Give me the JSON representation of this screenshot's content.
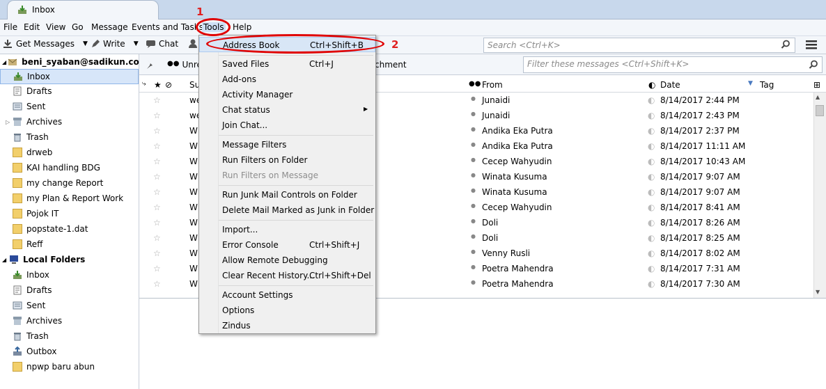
{
  "tab": {
    "title": "Inbox"
  },
  "menubar": [
    "File",
    "Edit",
    "View",
    "Go",
    "Message",
    "Events and Tasks",
    "Tools",
    "Help"
  ],
  "toolbar": {
    "get_messages": "Get Messages",
    "write": "Write",
    "chat": "Chat",
    "search_placeholder": "Search <Ctrl+K>"
  },
  "quickfilter": {
    "unread": "Unre",
    "attachment": "chment",
    "filter_placeholder": "Filter these messages <Ctrl+Shift+K>"
  },
  "columns": {
    "subject": "Su",
    "from": "From",
    "date": "Date",
    "tag": "Tag"
  },
  "folders": {
    "account1": "beni_syaban@sadikun.com",
    "account1_items": [
      "Inbox",
      "Drafts",
      "Sent",
      "Archives",
      "Trash",
      "drweb",
      "KAI handling BDG",
      "my change Report",
      "my Plan & Report Work",
      "Pojok IT",
      "popstate-1.dat",
      "Reff"
    ],
    "account2": "Local Folders",
    "account2_items": [
      "Inbox",
      "Drafts",
      "Sent",
      "Archives",
      "Trash",
      "Outbox",
      "npwp baru abun"
    ]
  },
  "messages": [
    {
      "subject": "we",
      "from": "Junaidi",
      "date": "8/14/2017 2:44 PM"
    },
    {
      "subject": "we",
      "from": "Junaidi",
      "date": "8/14/2017 2:43 PM"
    },
    {
      "subject": "W",
      "from": "Andika Eka Putra",
      "date": "8/14/2017 2:37 PM"
    },
    {
      "subject": "W",
      "from": "Andika Eka Putra",
      "date": "8/14/2017 11:11 AM"
    },
    {
      "subject": "W",
      "from": "Cecep Wahyudin",
      "date": "8/14/2017 10:43 AM"
    },
    {
      "subject": "W",
      "from": "Winata Kusuma",
      "date": "8/14/2017 9:07 AM"
    },
    {
      "subject": "W",
      "from": "Winata Kusuma",
      "date": "8/14/2017 9:07 AM"
    },
    {
      "subject": "W",
      "from": "Cecep Wahyudin",
      "date": "8/14/2017 8:41 AM"
    },
    {
      "subject": "W",
      "from": "Doli",
      "date": "8/14/2017 8:26 AM"
    },
    {
      "subject": "W",
      "from": "Doli",
      "date": "8/14/2017 8:25 AM"
    },
    {
      "subject": "W",
      "from": "Venny Rusli",
      "date": "8/14/2017 8:02 AM"
    },
    {
      "subject": "W",
      "from": "Poetra Mahendra",
      "date": "8/14/2017 7:31 AM"
    },
    {
      "subject": "W",
      "from": "Poetra Mahendra",
      "date": "8/14/2017 7:30 AM"
    }
  ],
  "tools_menu": [
    {
      "label": "Address Book",
      "shortcut": "Ctrl+Shift+B"
    },
    {
      "label": "Saved Files",
      "shortcut": "Ctrl+J"
    },
    {
      "label": "Add-ons",
      "shortcut": ""
    },
    {
      "label": "Activity Manager",
      "shortcut": ""
    },
    {
      "label": "Chat status",
      "shortcut": ""
    },
    {
      "label": "Join Chat...",
      "shortcut": ""
    },
    {
      "label": "Message Filters",
      "shortcut": ""
    },
    {
      "label": "Run Filters on Folder",
      "shortcut": ""
    },
    {
      "label": "Run Filters on Message",
      "shortcut": ""
    },
    {
      "label": "Run Junk Mail Controls on Folder",
      "shortcut": ""
    },
    {
      "label": "Delete Mail Marked as Junk in Folder",
      "shortcut": ""
    },
    {
      "label": "Import...",
      "shortcut": ""
    },
    {
      "label": "Error Console",
      "shortcut": "Ctrl+Shift+J"
    },
    {
      "label": "Allow Remote Debugging",
      "shortcut": ""
    },
    {
      "label": "Clear Recent History...",
      "shortcut": "Ctrl+Shift+Del"
    },
    {
      "label": "Account Settings",
      "shortcut": ""
    },
    {
      "label": "Options",
      "shortcut": ""
    },
    {
      "label": "Zindus",
      "shortcut": ""
    }
  ],
  "annotations": {
    "step1": "1",
    "step2": "2"
  },
  "colors": {
    "accent": "#d7e6f9",
    "annotation": "#e00000"
  }
}
